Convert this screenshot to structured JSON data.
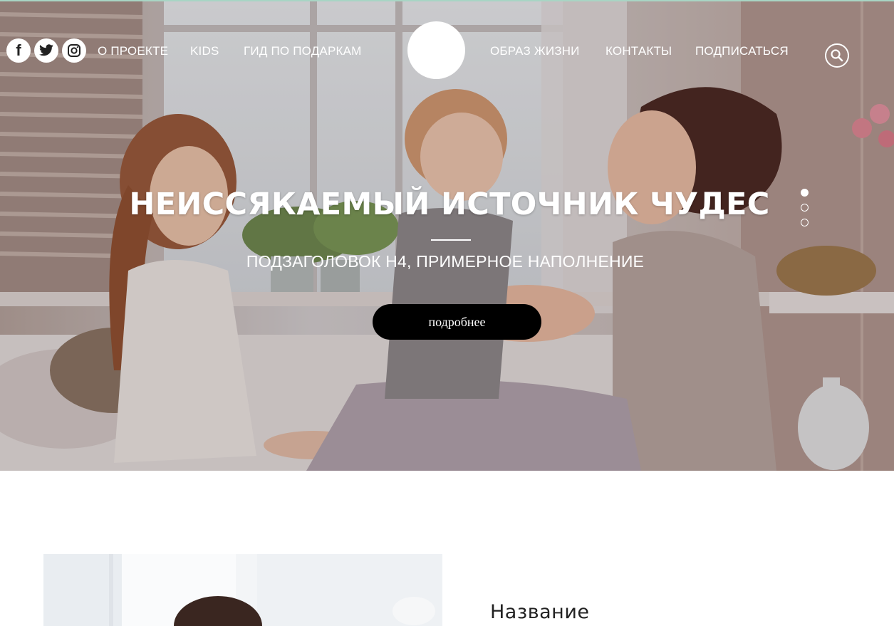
{
  "social": [
    {
      "icon": "facebook-icon",
      "label": "f"
    },
    {
      "icon": "twitter-icon",
      "label": ""
    },
    {
      "icon": "instagram-icon",
      "label": ""
    }
  ],
  "nav": {
    "left": [
      "О ПРОЕКТЕ",
      "KIDS",
      "ГИД ПО ПОДАРКАМ"
    ],
    "right": [
      "ОБРАЗ ЖИЗНИ",
      "КОНТАКТЫ",
      "ПОДПИСАТЬСЯ"
    ]
  },
  "hero": {
    "title": "НЕИССЯКАЕМЫЙ ИСТОЧНИК ЧУДЕС",
    "subtitle": "ПОДЗАГОЛОВОК H4, ПРИМЕРНОЕ НАПОЛНЕНИЕ",
    "button_label": "подробнее",
    "slides": 3,
    "active_slide": 1
  },
  "article": {
    "title": "Название"
  },
  "colors": {
    "accent_line": "#a8d5c4",
    "button_bg": "#000000",
    "text_dark": "#222222"
  }
}
